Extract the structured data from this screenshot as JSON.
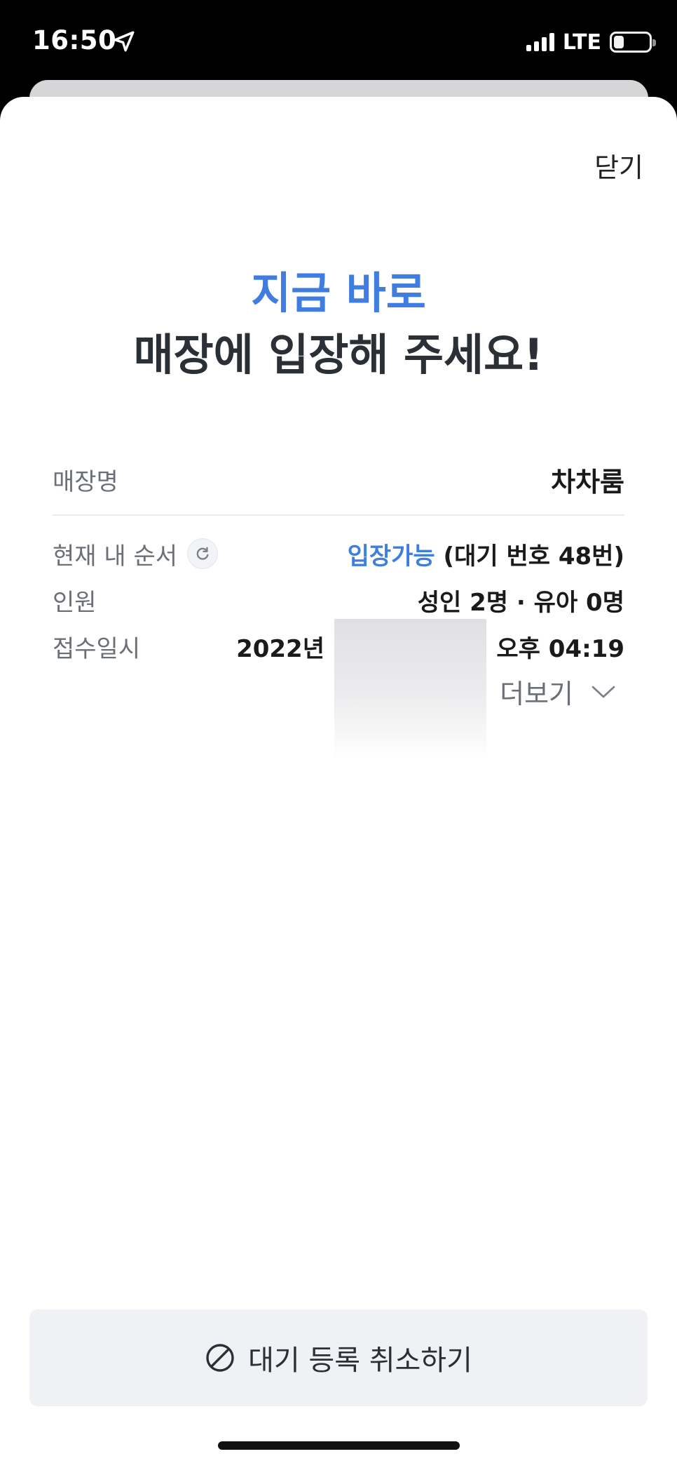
{
  "status_bar": {
    "time": "16:50",
    "network": "LTE",
    "location_icon": "location-arrow-icon",
    "battery_level": 0.3
  },
  "sheet": {
    "close_label": "닫기",
    "headline_accent": "지금 바로",
    "headline_main": "매장에 입장해 주세요!",
    "store": {
      "label": "매장명",
      "value": "차차룸"
    },
    "rows": {
      "order": {
        "label": "현재 내 순서",
        "status": "입장가능",
        "detail": "(대기 번호 48번)"
      },
      "party": {
        "label": "인원",
        "value": "성인 2명 · 유아 0명"
      },
      "received": {
        "label": "접수일시",
        "value_start": "2022년",
        "value_end": ") 오후 04:19"
      }
    },
    "more_label": "더보기",
    "cancel_label": "대기 등록 취소하기"
  },
  "colors": {
    "accent": "#3f7ee0",
    "text_dark": "#2b2f36",
    "button_bg": "#f0f1f5"
  }
}
